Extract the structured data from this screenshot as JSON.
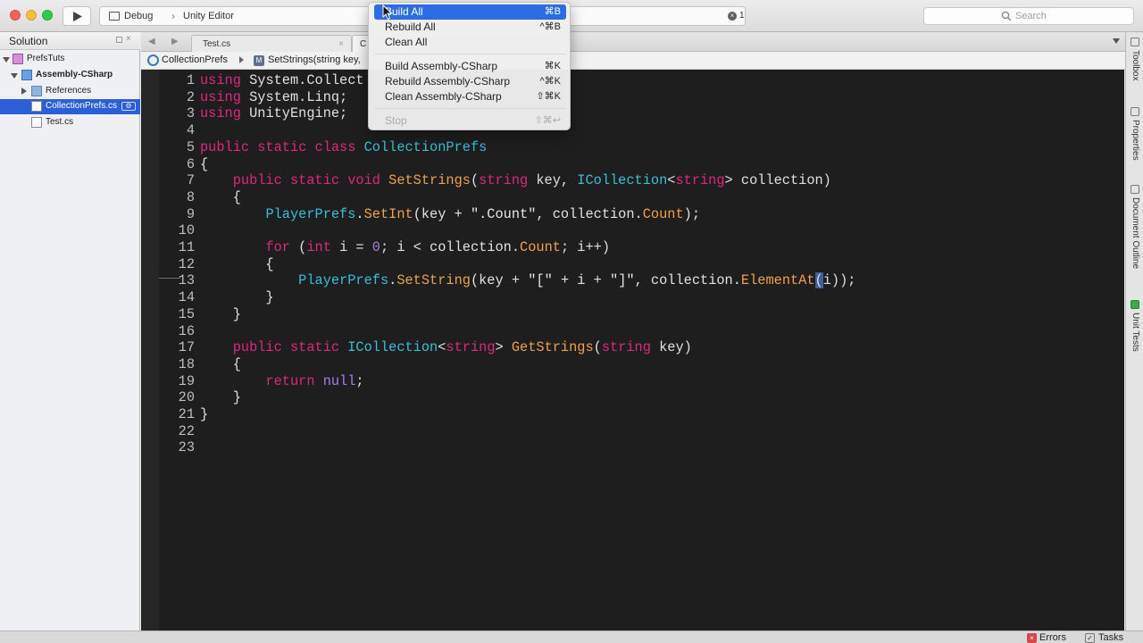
{
  "toolbar": {
    "config": "Debug",
    "separator": "›",
    "target": "Unity Editor",
    "error_icon": "×",
    "error_count": "1",
    "search_placeholder": "Search"
  },
  "solution": {
    "title": "Solution",
    "close": "×",
    "tree": [
      {
        "label": "PrefsTuts",
        "icon": "solution-icon"
      },
      {
        "label": "Assembly-CSharp",
        "icon": "project-icon"
      },
      {
        "label": "References",
        "icon": "folder-icon"
      },
      {
        "label": "CollectionPrefs.cs",
        "icon": "file-icon",
        "selected": true
      },
      {
        "label": "Test.cs",
        "icon": "file-icon"
      }
    ],
    "gear": "⚙"
  },
  "tabs": {
    "back": "◀",
    "forward": "▶",
    "items": [
      {
        "label": "Test.cs",
        "close": "×"
      },
      {
        "label": "C",
        "close": ""
      }
    ]
  },
  "breadcrumb": {
    "class_name": "CollectionPrefs",
    "method_icon": "M",
    "method": "SetStrings(string key, "
  },
  "editor": {
    "lines": [
      {
        "n": "1",
        "html": "<span class='k'>using</span> System.Collect"
      },
      {
        "n": "2",
        "html": "<span class='k'>using</span> System.Linq;"
      },
      {
        "n": "3",
        "html": "<span class='k'>using</span> UnityEngine;"
      },
      {
        "n": "4",
        "html": ""
      },
      {
        "n": "5",
        "html": "<span class='k'>public static class</span> <span class='t'>CollectionPrefs</span>"
      },
      {
        "n": "6",
        "html": "{"
      },
      {
        "n": "7",
        "html": "    <span class='k'>public static void</span> <span class='m'>SetStrings</span>(<span class='k'>string</span> key, <span class='t'>ICollection</span>&lt;<span class='k'>string</span>&gt; collection)"
      },
      {
        "n": "8",
        "html": "    {"
      },
      {
        "n": "9",
        "html": "        <span class='t'>PlayerPrefs</span>.<span class='m'>SetInt</span>(key + <span class='s'>\".Count\"</span>, collection.<span class='m'>Count</span>);"
      },
      {
        "n": "10",
        "html": ""
      },
      {
        "n": "11",
        "html": "        <span class='k'>for</span> (<span class='k'>int</span> i = <span class='n'>0</span>; i &lt; collection.<span class='m'>Count</span>; i++)"
      },
      {
        "n": "12",
        "html": "        {"
      },
      {
        "n": "13",
        "html": "            <span class='t'>PlayerPrefs</span>.<span class='m'>SetString</span>(key + <span class='s'>\"[\"</span> + i + <span class='s'>\"]\"</span>, collection.<span class='m'>ElementAt</span><span class='hl'>(</span>i));"
      },
      {
        "n": "14",
        "html": "        }"
      },
      {
        "n": "15",
        "html": "    }"
      },
      {
        "n": "16",
        "html": ""
      },
      {
        "n": "17",
        "html": "    <span class='k'>public static</span> <span class='t'>ICollection</span>&lt;<span class='k'>string</span>&gt; <span class='m'>GetStrings</span>(<span class='k'>string</span> key)"
      },
      {
        "n": "18",
        "html": "    {"
      },
      {
        "n": "19",
        "html": "        <span class='k'>return</span> <span class='n'>null</span>;"
      },
      {
        "n": "20",
        "html": "    }"
      },
      {
        "n": "21",
        "html": "}"
      },
      {
        "n": "22",
        "html": ""
      },
      {
        "n": "23",
        "html": ""
      }
    ]
  },
  "build_menu": {
    "items": [
      {
        "label": "Build All",
        "shortcut": "⌘B",
        "active": true
      },
      {
        "label": "Rebuild All",
        "shortcut": "^⌘B"
      },
      {
        "label": "Clean All",
        "shortcut": ""
      },
      {
        "separator": true
      },
      {
        "label": "Build Assembly-CSharp",
        "shortcut": "⌘K"
      },
      {
        "label": "Rebuild Assembly-CSharp",
        "shortcut": "^⌘K"
      },
      {
        "label": "Clean Assembly-CSharp",
        "shortcut": "⇧⌘K"
      },
      {
        "separator": true
      },
      {
        "label": "Stop",
        "shortcut": "⇧⌘↩",
        "disabled": true
      }
    ]
  },
  "right_dock": {
    "items": [
      {
        "label": "Toolbox",
        "icon": "toolbox-icon"
      },
      {
        "label": "Properties",
        "icon": "properties-icon"
      },
      {
        "label": "Document Outline",
        "icon": "document-outline-icon"
      },
      {
        "label": "Unit Tests",
        "icon": "unit-tests-icon"
      }
    ]
  },
  "statusbar": {
    "errors_icon": "×",
    "errors": "Errors",
    "tasks_icon": "✓",
    "tasks": "Tasks"
  },
  "colors": {
    "editor_bg": "#1e1e1e",
    "keyword": "#e0267e",
    "type": "#34c0d8",
    "method": "#f0a14a",
    "selection": "#2a5fd7",
    "menu_highlight": "#2c6ce5"
  }
}
